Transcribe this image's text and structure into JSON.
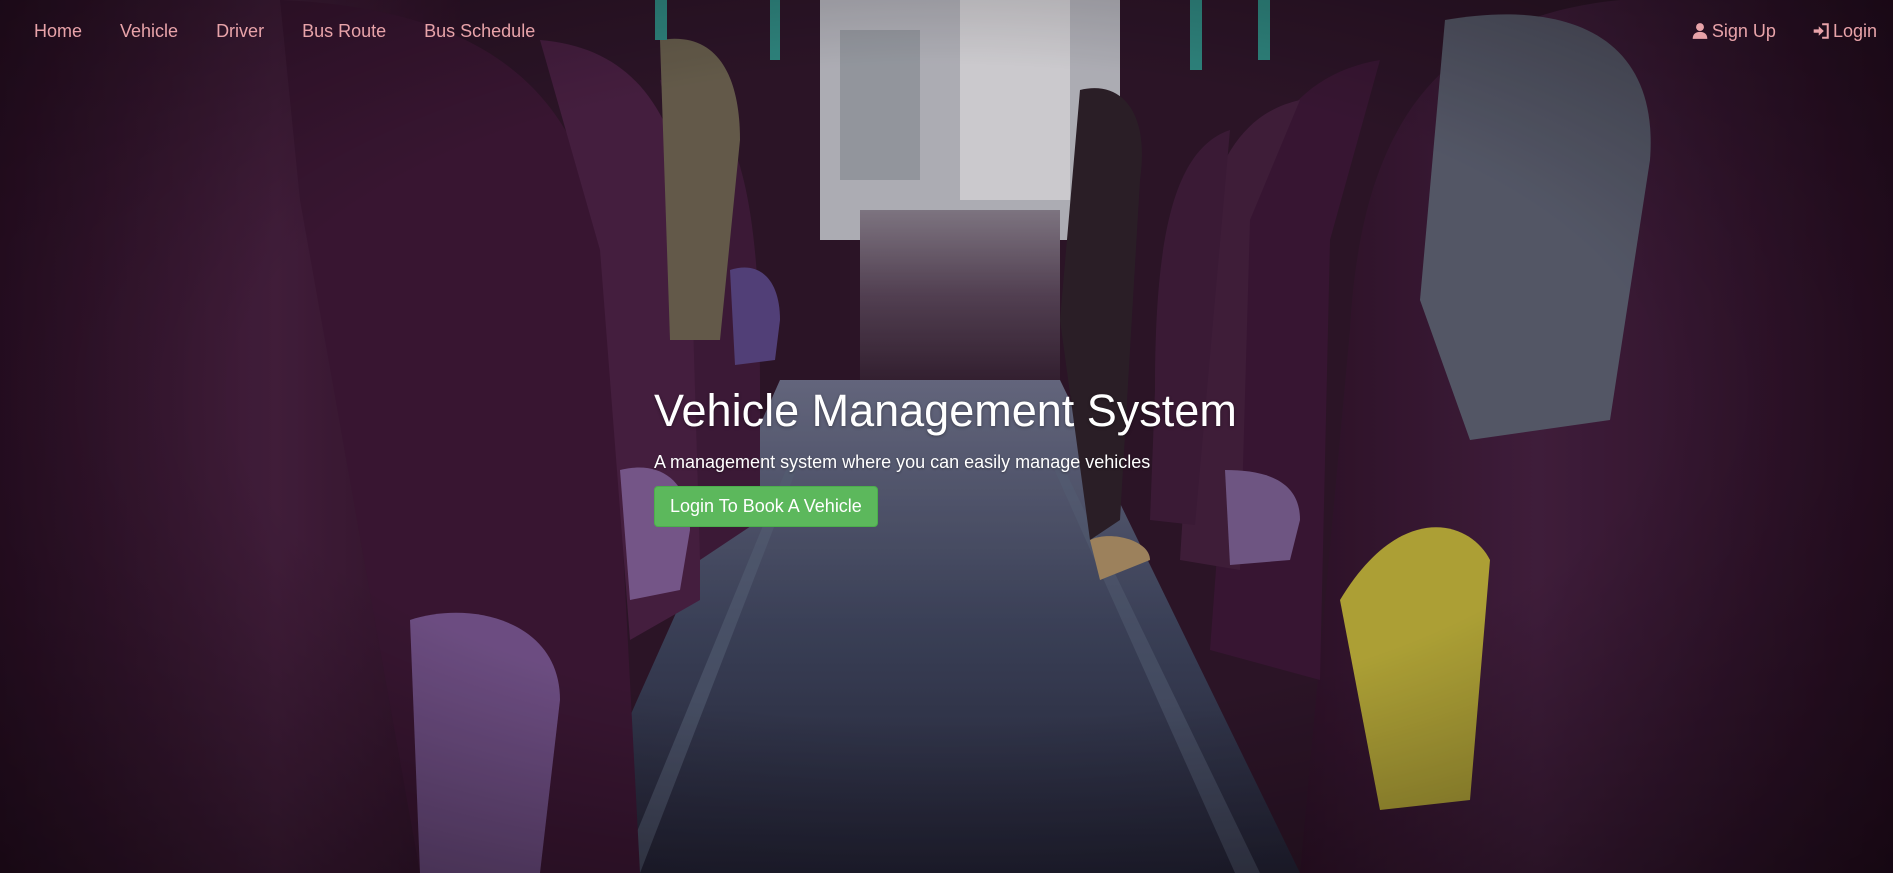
{
  "navbar": {
    "left_items": [
      {
        "label": "Home"
      },
      {
        "label": "Vehicle"
      },
      {
        "label": "Driver"
      },
      {
        "label": "Bus Route"
      },
      {
        "label": "Bus Schedule"
      }
    ],
    "right_items": [
      {
        "label": "Sign Up",
        "icon": "user-icon"
      },
      {
        "label": "Login",
        "icon": "login-icon"
      }
    ],
    "link_color": "#e8a3a9"
  },
  "hero": {
    "title": "Vehicle Management System",
    "subtitle": "A management system where you can easily manage vehicles",
    "cta_label": "Login To Book A Vehicle",
    "cta_color": "#5cb85c",
    "background": "bus-interior-photo"
  }
}
